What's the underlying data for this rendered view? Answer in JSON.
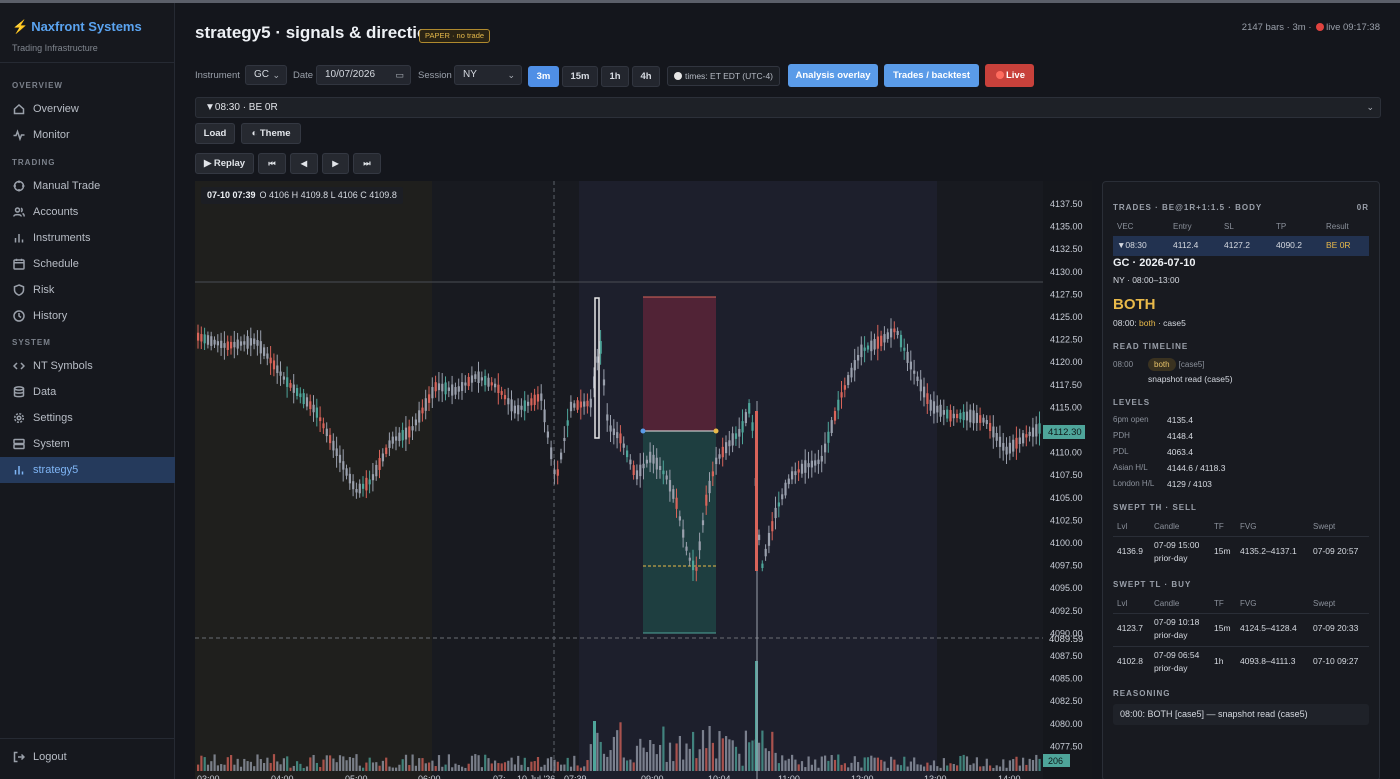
{
  "app": {
    "brand": "Naxfront Systems",
    "subtitle": "Trading Infrastructure"
  },
  "sidebar": {
    "sections": [
      "OVERVIEW",
      "TRADING",
      "SYSTEM"
    ],
    "items": [
      {
        "label": "Overview",
        "icon": "home-icon"
      },
      {
        "label": "Monitor",
        "icon": "pulse-icon"
      },
      {
        "label": "Manual Trade",
        "icon": "crosshair-icon"
      },
      {
        "label": "Accounts",
        "icon": "users-icon"
      },
      {
        "label": "Instruments",
        "icon": "bars-icon"
      },
      {
        "label": "Schedule",
        "icon": "calendar-icon"
      },
      {
        "label": "Risk",
        "icon": "shield-icon"
      },
      {
        "label": "History",
        "icon": "clock-icon"
      },
      {
        "label": "NT Symbols",
        "icon": "code-icon"
      },
      {
        "label": "Data",
        "icon": "database-icon"
      },
      {
        "label": "Settings",
        "icon": "gear-icon"
      },
      {
        "label": "System",
        "icon": "server-icon"
      },
      {
        "label": "strategy5",
        "icon": "bars-icon",
        "active": true
      }
    ],
    "logout": "Logout"
  },
  "header": {
    "title": "strategy5 · signals & direction",
    "badge": "PAPER · no trade",
    "status_prefix": "2147 bars · 3m ·",
    "status_live": "live 09:17:38"
  },
  "toolbar": {
    "instrument_label": "Instrument",
    "instrument": "GC",
    "date_label": "Date",
    "date": "10/07/2026",
    "session_label": "Session",
    "session": "NY",
    "timeframes": [
      "3m",
      "15m",
      "1h",
      "4h"
    ],
    "active_timeframe": "3m",
    "timezone": "times: ET EDT (UTC-4)",
    "analysis_button": "Analysis overlay",
    "trades_button": "Trades / backtest",
    "live_button": "Live",
    "trade_select": "▼08:30 · BE 0R",
    "load_button": "Load",
    "theme_button": "◐ Theme",
    "replay_button": "▶ Replay",
    "replay_controls": [
      "⏮",
      "◀",
      "▶",
      "⏭"
    ]
  },
  "chart": {
    "ohlc_time": "07-10 07:39",
    "ohlc_text": "O 4106  H 4109.8  L 4106  C 4109.8",
    "price_ticks": [
      "4137.50",
      "4135.00",
      "4132.50",
      "4130.00",
      "4127.50",
      "4125.00",
      "4122.50",
      "4120.00",
      "4117.50",
      "4115.00",
      "4112.50",
      "4110.00",
      "4107.50",
      "4105.00",
      "4102.50",
      "4100.00",
      "4097.50",
      "4095.00",
      "4092.50",
      "4090.00",
      "4087.50",
      "4085.00",
      "4082.50",
      "4080.00",
      "4077.50"
    ],
    "last_price": "4112.30",
    "dashed_price": "4089.59",
    "volume_label": "206",
    "time_ticks": [
      "03:00",
      "04:00",
      "05:00",
      "06:00",
      "07:",
      "10 Jul '26",
      "07:39",
      "09:00",
      "10:04",
      "11:00",
      "12:00",
      "13:00",
      "14:00"
    ],
    "colors": {
      "up": "#4ea59a",
      "down": "#d9645a",
      "neutral": "#9aa0ad",
      "stop_zone": "#5a2538",
      "target_zone": "#1f4444"
    }
  },
  "panel": {
    "trades_header": "TRADES · BE@1R+1:1.5 · BODY",
    "trades_count": "0R",
    "trade_columns": [
      "VEC",
      "Entry",
      "SL",
      "TP",
      "Result"
    ],
    "trade_row": [
      "▼08:30",
      "4112.4",
      "4127.2",
      "4090.2",
      "BE 0R"
    ],
    "instrument_date": "GC · 2026-07-10",
    "session_window": "NY · 08:00–13:00",
    "direction": "BOTH",
    "direction_time": "08:00:",
    "direction_value": "both",
    "direction_case": "· case5",
    "timeline_header": "READ TIMELINE",
    "timeline": {
      "time": "08:00",
      "tag": "both",
      "case": "[case5]",
      "note": "snapshot read (case5)"
    },
    "levels_header": "LEVELS",
    "levels": [
      [
        "6pm open",
        "4135.4"
      ],
      [
        "PDH",
        "4148.4"
      ],
      [
        "PDL",
        "4063.4"
      ],
      [
        "Asian H/L",
        "4144.6 / 4118.3"
      ],
      [
        "London H/L",
        "4129 / 4103"
      ]
    ],
    "swept_th_header": "SWEPT TH · SELL",
    "swept_columns": [
      "Lvl",
      "Candle",
      "TF",
      "FVG",
      "Swept"
    ],
    "swept_th": [
      [
        "4136.9",
        "07-09 15:00",
        "prior-day",
        "15m",
        "4135.2–4137.1",
        "07-09 20:57"
      ]
    ],
    "swept_tl_header": "SWEPT TL · BUY",
    "swept_tl": [
      [
        "4123.7",
        "07-09 10:18",
        "prior-day",
        "15m",
        "4124.5–4128.4",
        "07-09 20:33"
      ],
      [
        "4102.8",
        "07-09 06:54",
        "prior-day",
        "1h",
        "4093.8–4111.3",
        "07-10 09:27"
      ]
    ],
    "reasoning_header": "REASONING",
    "reasoning": "08:00: BOTH [case5] — snapshot read (case5)"
  }
}
